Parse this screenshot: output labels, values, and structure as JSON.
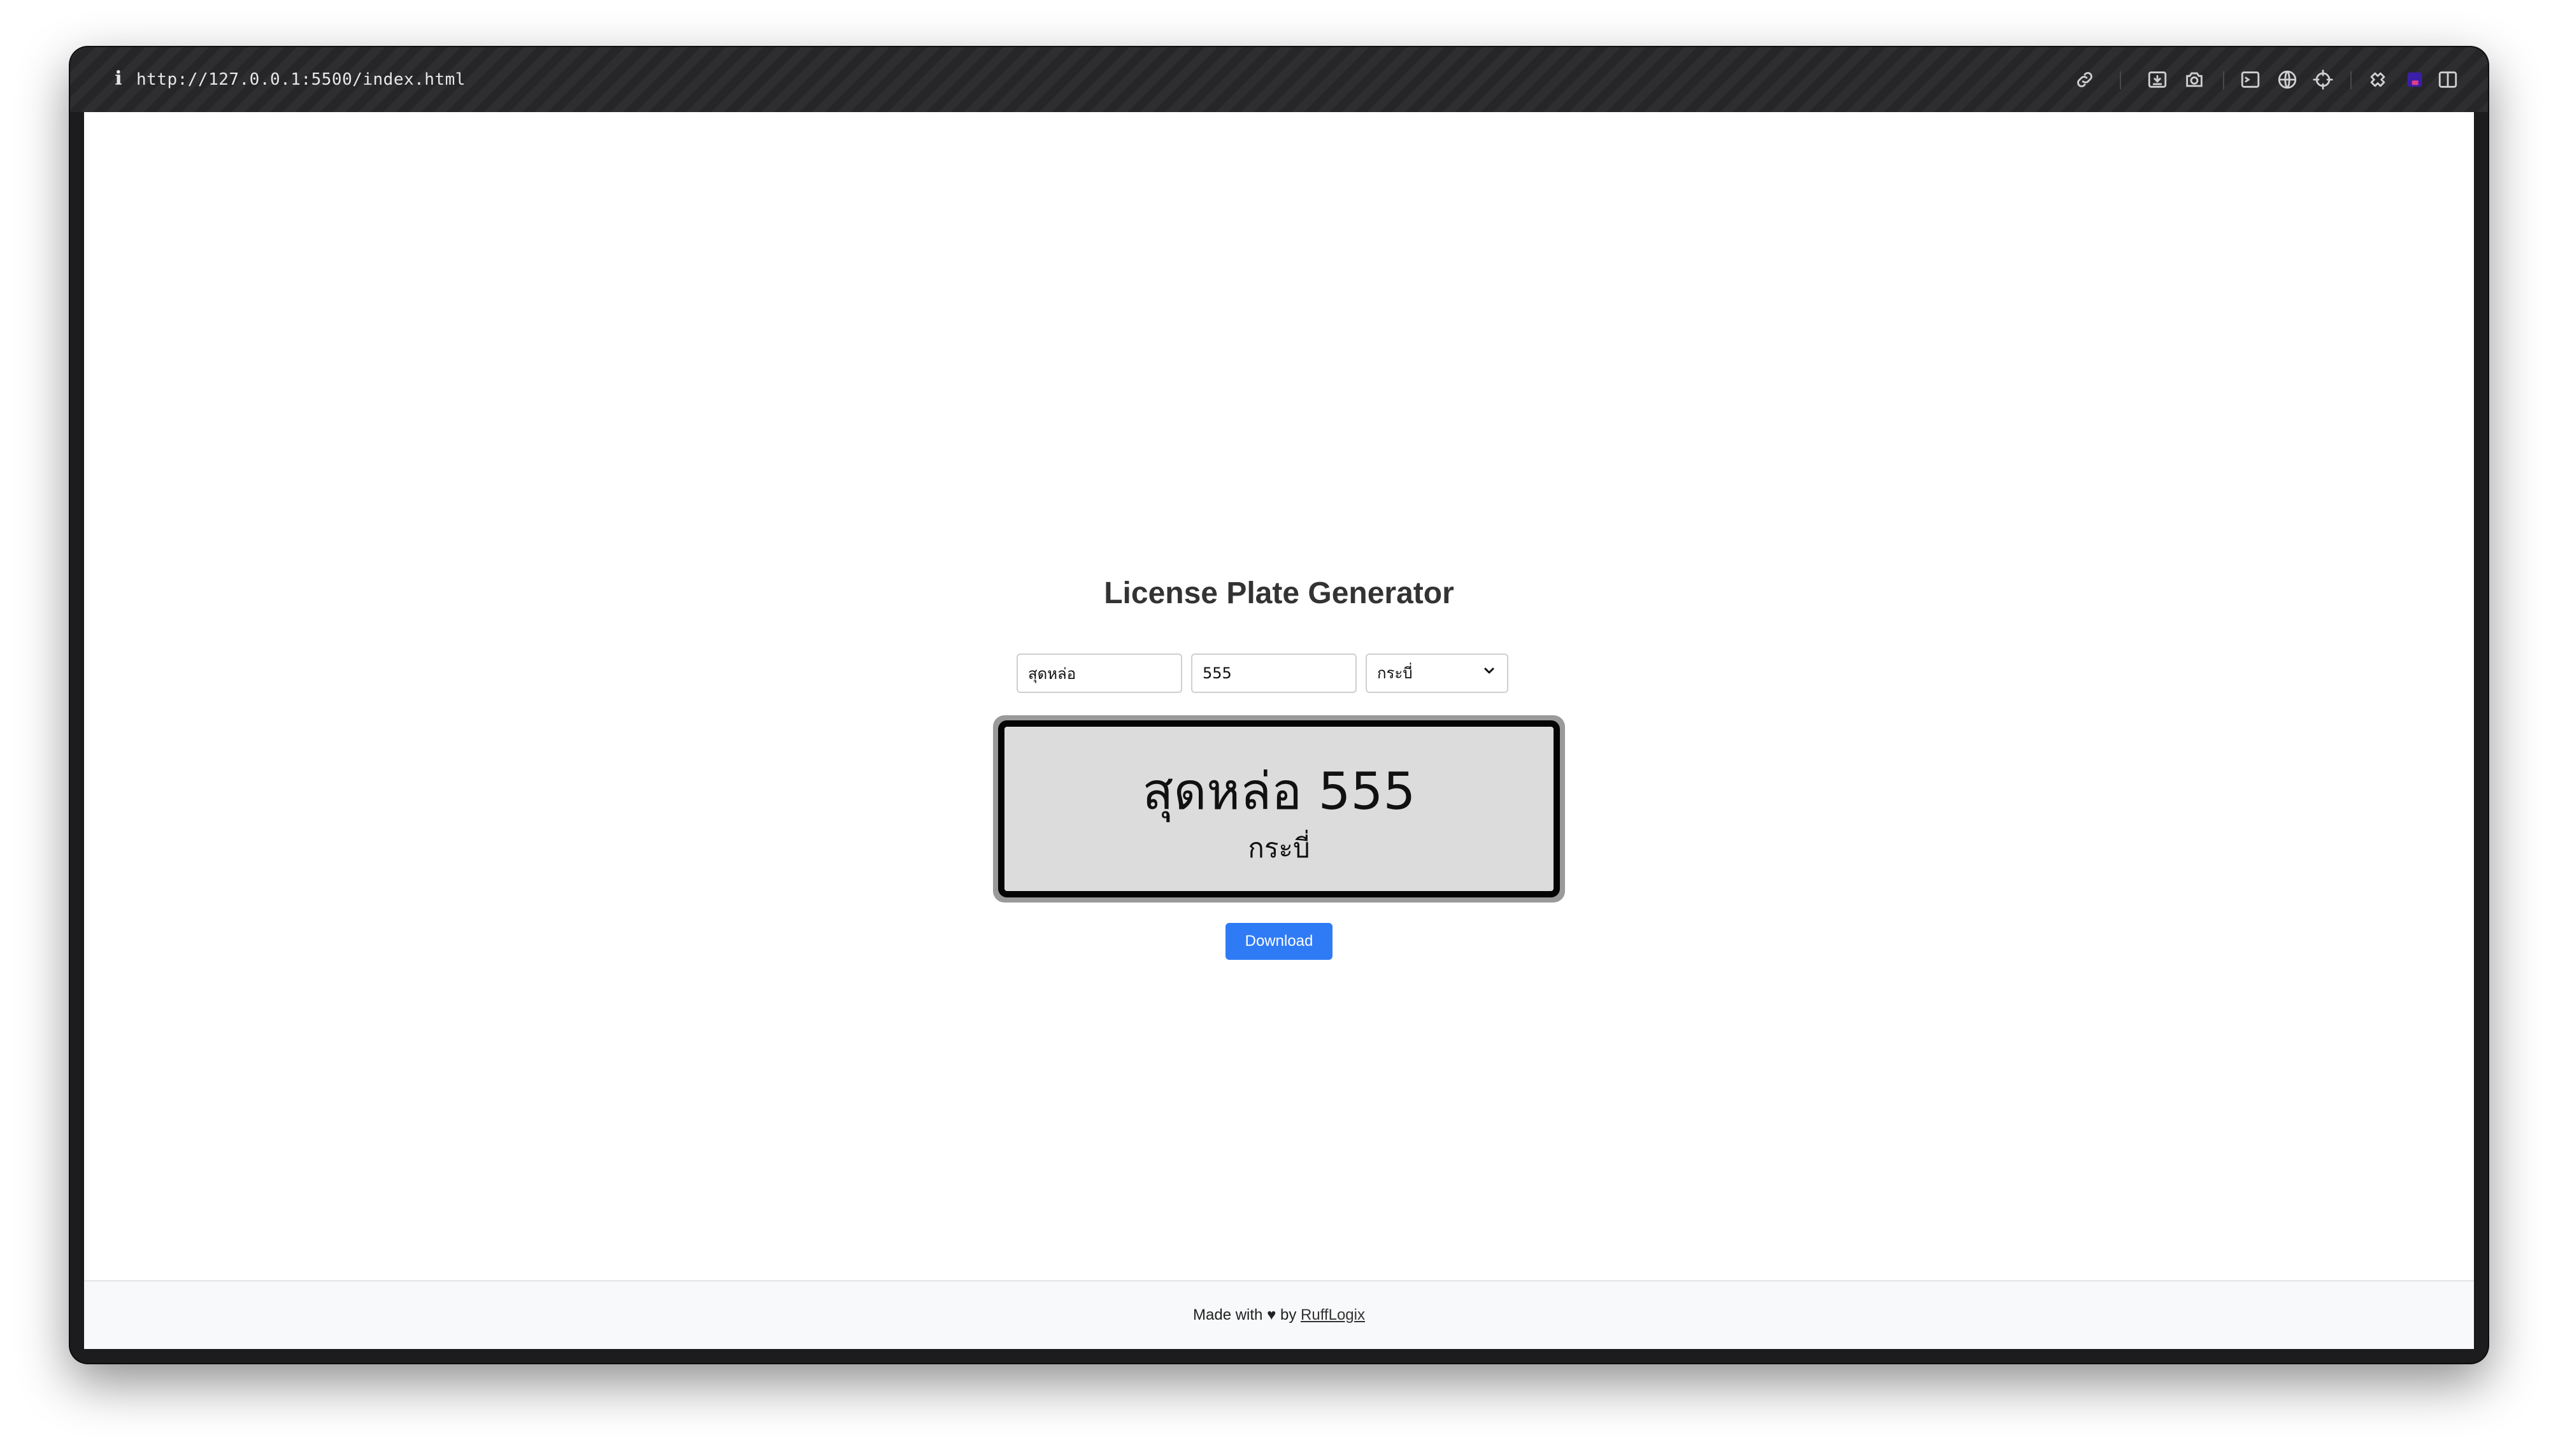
{
  "browser": {
    "url": "http://127.0.0.1:5500/index.html",
    "toolbar_icons": [
      "link-icon",
      "download-icon",
      "camera-icon",
      "terminal-icon",
      "globe-icon",
      "crosshair-icon",
      "extensions-icon",
      "profile-icon",
      "sidebar-icon"
    ]
  },
  "page": {
    "title": "License Plate Generator",
    "inputs": {
      "letters_value": "สุดหล่อ",
      "number_value": "555",
      "province_selected": "กระบี่"
    },
    "plate": {
      "letters": "สุดหล่อ",
      "number": "555",
      "province": "กระบี่"
    },
    "download_label": "Download"
  },
  "footer": {
    "prefix": "Made with",
    "heart": "♥",
    "by": "by",
    "link_text": "RuffLogix"
  },
  "colors": {
    "accent": "#2f7bf6",
    "plate_background": "#dcdcdc",
    "plate_border": "#050505",
    "title": "#333333"
  }
}
